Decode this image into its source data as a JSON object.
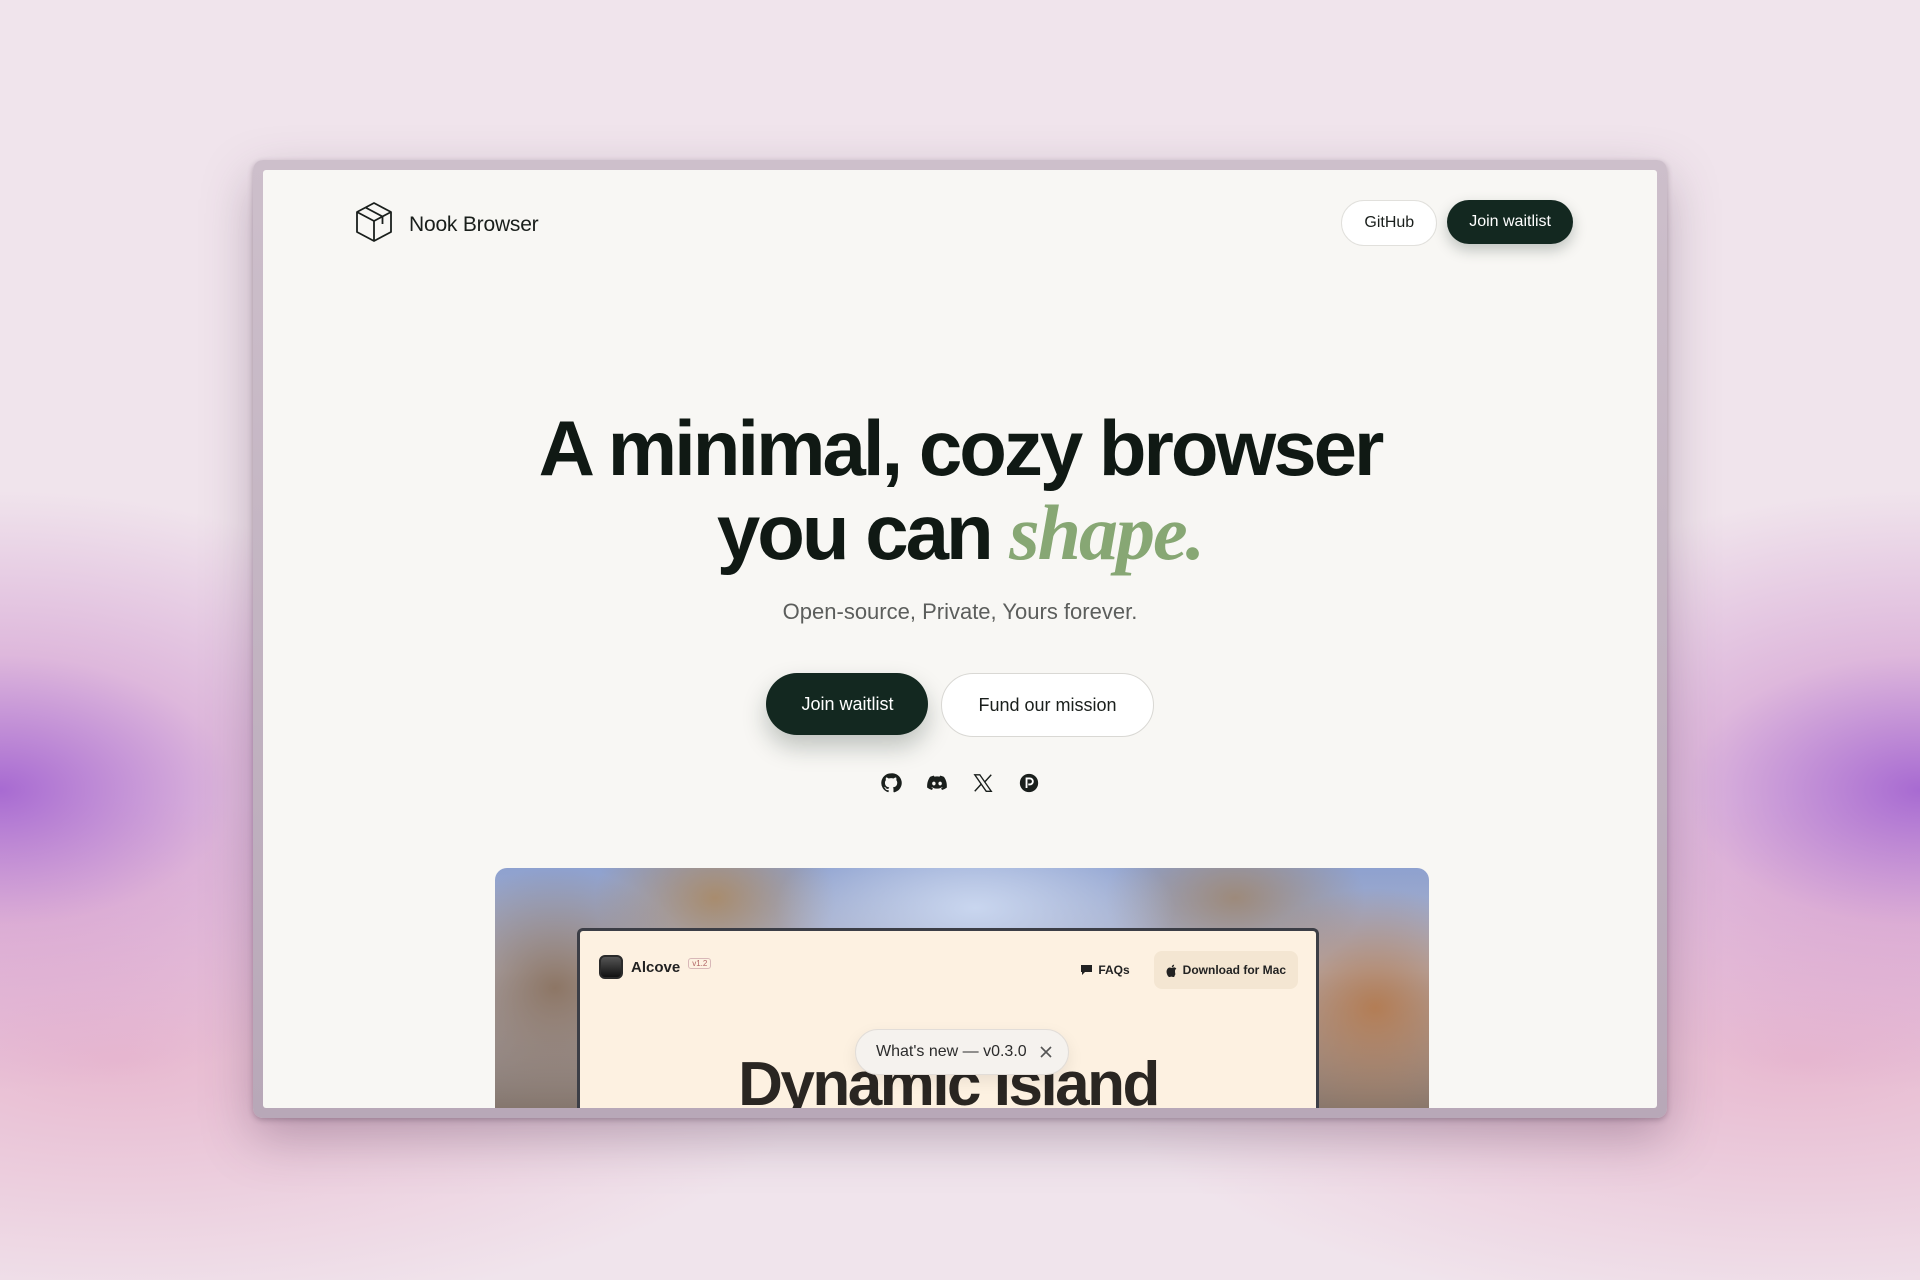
{
  "brand": {
    "name": "Nook Browser",
    "icon": "cube-icon"
  },
  "nav": {
    "github_label": "GitHub",
    "waitlist_label": "Join waitlist"
  },
  "hero": {
    "title_line1": "A minimal, cozy browser",
    "title_line2_prefix": "you can ",
    "title_line2_accent": "shape.",
    "subtitle": "Open-source, Private, Yours forever.",
    "accent_color": "#87a774"
  },
  "cta": {
    "primary_label": "Join waitlist",
    "secondary_label": "Fund our mission"
  },
  "socials": [
    "github-icon",
    "discord-icon",
    "x-icon",
    "patreon-icon"
  ],
  "preview": {
    "app_name": "Alcove",
    "version": "v1.2",
    "faq_label": "FAQs",
    "download_label": "Download for Mac",
    "heading": "Dynamic Island"
  },
  "toast": {
    "text": "What's new — v0.3.0"
  },
  "colors": {
    "dark": "#132820",
    "page_bg": "#f8f7f4"
  }
}
